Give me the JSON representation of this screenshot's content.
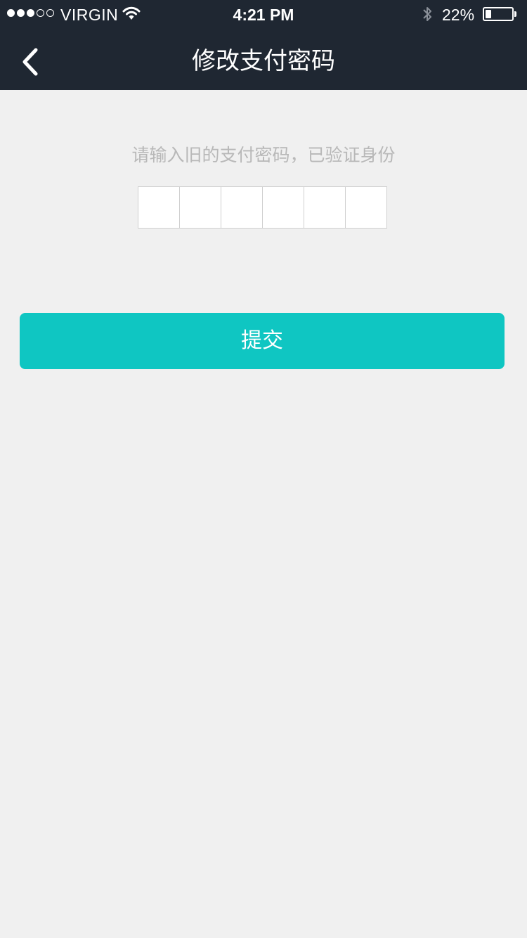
{
  "status_bar": {
    "signal_bars_filled": 3,
    "signal_bars_total": 5,
    "carrier": "VIRGIN",
    "time": "4:21 PM",
    "bluetooth_icon": "bluetooth-icon",
    "battery_percent": "22%",
    "battery_level": 0.22
  },
  "nav": {
    "back_icon": "chevron-left-icon",
    "title": "修改支付密码"
  },
  "form": {
    "hint": "请输入旧的支付密码，已验证身份",
    "pin_values": [
      "",
      "",
      "",
      "",
      "",
      ""
    ]
  },
  "submit": {
    "label": "提交"
  },
  "colors": {
    "header_bg": "#1f2732",
    "page_bg": "#f0f0f0",
    "accent": "#0fc6c2",
    "hint_text": "#b8b8b8"
  }
}
